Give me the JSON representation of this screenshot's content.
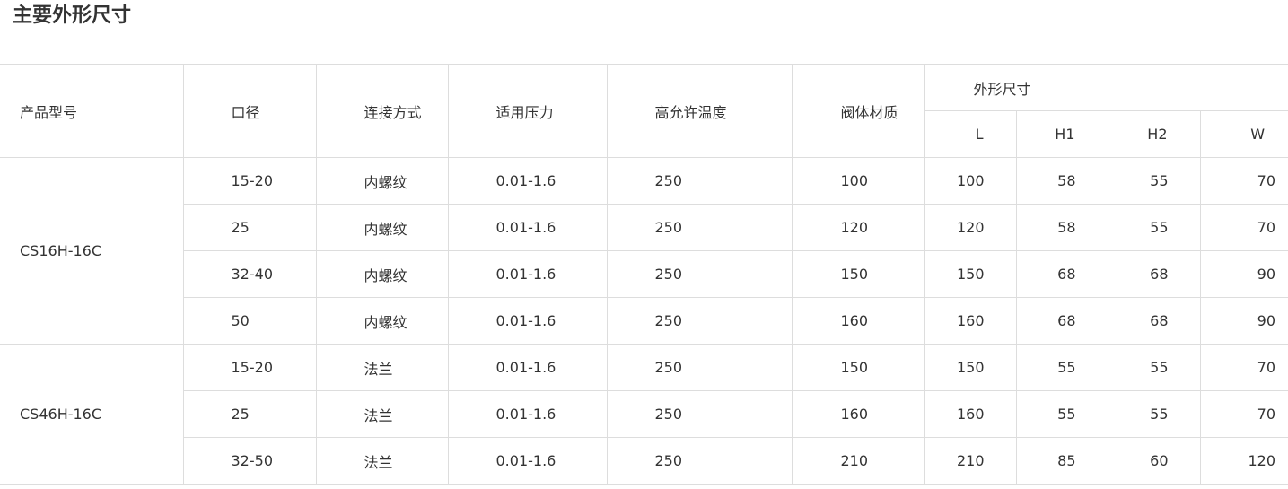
{
  "title": "主要外形尺寸",
  "table": {
    "headers": {
      "model": "产品型号",
      "diameter": "口径",
      "connection": "连接方式",
      "pressure": "适用压力",
      "temperature": "高允许温度",
      "material": "阀体材质",
      "dimensions": "外形尺寸",
      "dim_cols": [
        "L",
        "H1",
        "H2",
        "W"
      ]
    },
    "groups": [
      {
        "model": "CS16H-16C",
        "rows": [
          {
            "dn": "15-20",
            "conn": "内螺纹",
            "press": "0.01-1.6",
            "temp": "250",
            "mat": "100",
            "L": "100",
            "H1": "58",
            "H2": "55",
            "W": "70"
          },
          {
            "dn": "25",
            "conn": "内螺纹",
            "press": "0.01-1.6",
            "temp": "250",
            "mat": "120",
            "L": "120",
            "H1": "58",
            "H2": "55",
            "W": "70"
          },
          {
            "dn": "32-40",
            "conn": "内螺纹",
            "press": "0.01-1.6",
            "temp": "250",
            "mat": "150",
            "L": "150",
            "H1": "68",
            "H2": "68",
            "W": "90"
          },
          {
            "dn": "50",
            "conn": "内螺纹",
            "press": "0.01-1.6",
            "temp": "250",
            "mat": "160",
            "L": "160",
            "H1": "68",
            "H2": "68",
            "W": "90"
          }
        ]
      },
      {
        "model": "CS46H-16C",
        "rows": [
          {
            "dn": "15-20",
            "conn": "法兰",
            "press": "0.01-1.6",
            "temp": "250",
            "mat": "150",
            "L": "150",
            "H1": "55",
            "H2": "55",
            "W": "70"
          },
          {
            "dn": "25",
            "conn": "法兰",
            "press": "0.01-1.6",
            "temp": "250",
            "mat": "160",
            "L": "160",
            "H1": "55",
            "H2": "55",
            "W": "70"
          },
          {
            "dn": "32-50",
            "conn": "法兰",
            "press": "0.01-1.6",
            "temp": "250",
            "mat": "210",
            "L": "210",
            "H1": "85",
            "H2": "60",
            "W": "120"
          }
        ]
      }
    ]
  }
}
